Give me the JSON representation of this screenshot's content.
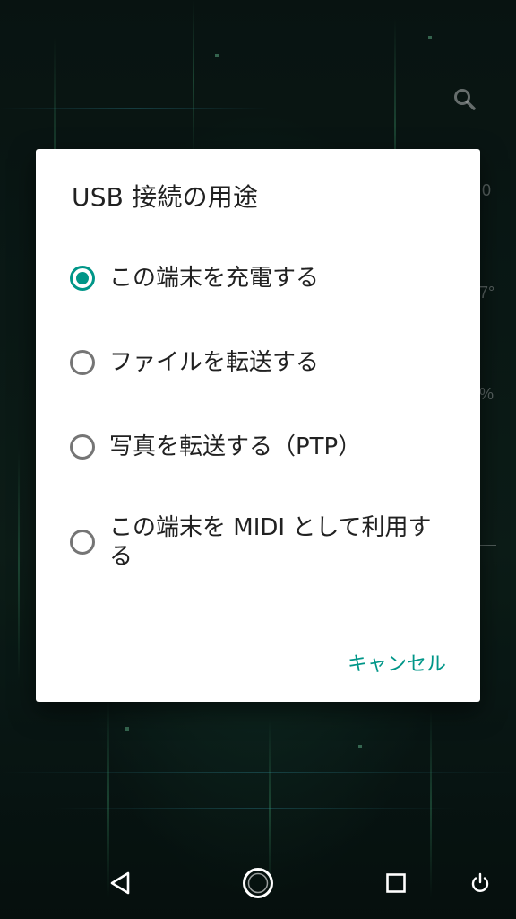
{
  "background": {
    "search_icon": "search-icon",
    "edge_text_1": "0",
    "edge_text_2": "7°",
    "edge_text_3": "%"
  },
  "dialog": {
    "title": "USB 接続の用途",
    "options": [
      {
        "label": "この端末を充電する",
        "selected": true
      },
      {
        "label": "ファイルを転送する",
        "selected": false
      },
      {
        "label": "写真を転送する（PTP）",
        "selected": false
      },
      {
        "label": "この端末を MIDI として利用する",
        "selected": false
      }
    ],
    "cancel_label": "キャンセル",
    "accent_color": "#009688"
  },
  "navbar": {
    "back_icon": "back-icon",
    "home_icon": "home-icon",
    "recents_icon": "recents-icon",
    "power_icon": "power-icon"
  }
}
